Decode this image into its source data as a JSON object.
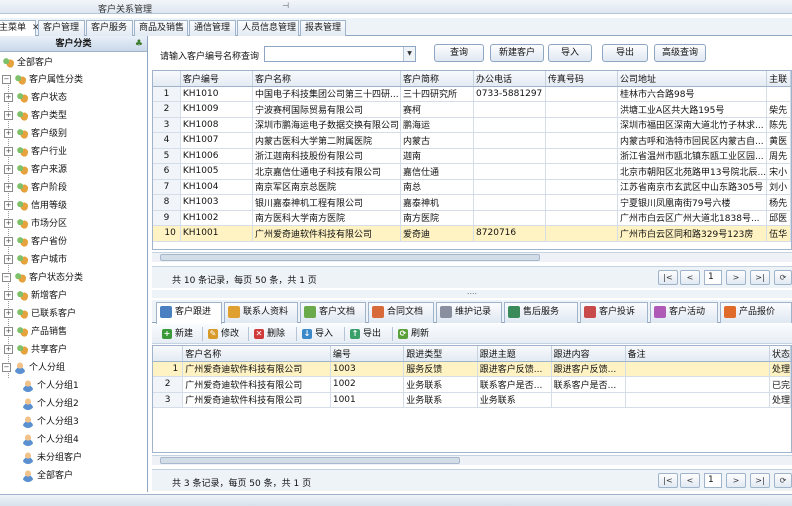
{
  "window": {
    "title": "客户关系管理"
  },
  "menu_tabs": [
    {
      "label": "主菜单"
    },
    {
      "label": "客户管理"
    },
    {
      "label": "客户服务"
    },
    {
      "label": "商品及销售"
    },
    {
      "label": "通信管理"
    },
    {
      "label": "人员信息管理"
    },
    {
      "label": "报表管理"
    }
  ],
  "sidebar": {
    "title": "客户分类",
    "items": [
      {
        "label": "全部客户"
      },
      {
        "label": "客户属性分类"
      },
      {
        "label": "客户状态"
      },
      {
        "label": "客户类型"
      },
      {
        "label": "客户级别"
      },
      {
        "label": "客户行业"
      },
      {
        "label": "客户来源"
      },
      {
        "label": "客户阶段"
      },
      {
        "label": "信用等级"
      },
      {
        "label": "市场分区"
      },
      {
        "label": "客户省份"
      },
      {
        "label": "客户城市"
      },
      {
        "label": "客户状态分类"
      },
      {
        "label": "新增客户"
      },
      {
        "label": "已联系客户"
      },
      {
        "label": "产品销售"
      },
      {
        "label": "共享客户"
      },
      {
        "label": "个人分组"
      },
      {
        "label": "个人分组1"
      },
      {
        "label": "个人分组2"
      },
      {
        "label": "个人分组3"
      },
      {
        "label": "个人分组4"
      },
      {
        "label": "未分组客户"
      },
      {
        "label": "全部客户"
      }
    ]
  },
  "search": {
    "label": "请输入客户编号名称查询",
    "value": "",
    "buttons": [
      "查询",
      "新建客户",
      "导入",
      "导出",
      "高级查询"
    ]
  },
  "customers": {
    "columns": [
      "",
      "客户编号",
      "客户名称",
      "客户简称",
      "办公电话",
      "传真号码",
      "公司地址",
      "主联"
    ],
    "rows": [
      [
        "1",
        "KH1010",
        "中国电子科技集团公司第三十四研...",
        "三十四研究所",
        "0733-5881297",
        "",
        "桂林市六合路98号",
        ""
      ],
      [
        "2",
        "KH1009",
        "宁波赛柯国际贸易有限公司",
        "赛柯",
        "",
        "",
        "洪塘工业A区共大路195号",
        "柴先"
      ],
      [
        "3",
        "KH1008",
        "深圳市鹏海运电子数据交换有限公司",
        "鹏海运",
        "",
        "",
        "深圳市福田区深南大道北竹子林求...",
        "陈先"
      ],
      [
        "4",
        "KH1007",
        "内蒙古医科大学第二附属医院",
        "内蒙古",
        "",
        "",
        "内蒙古呼和浩特市回民区内蒙古自...",
        "黄医"
      ],
      [
        "5",
        "KH1006",
        "浙江迦南科技股份有限公司",
        "迦南",
        "",
        "",
        "浙江省温州市瓯北镇东瓯工业区园...",
        "周先"
      ],
      [
        "6",
        "KH1005",
        "北京嘉信仕通电子科技有限公司",
        "嘉信仕通",
        "",
        "",
        "北京市朝阳区北苑路甲13号院北辰...",
        "宋小"
      ],
      [
        "7",
        "KH1004",
        "南京军区南京总医院",
        "南总",
        "",
        "",
        "江苏省南京市玄武区中山东路305号",
        "刘小"
      ],
      [
        "8",
        "KH1003",
        "银川嘉泰神机工程有限公司",
        "嘉泰神机",
        "",
        "",
        "宁夏银川凤凰南街79号六楼",
        "杨先"
      ],
      [
        "9",
        "KH1002",
        "南方医科大学南方医院",
        "南方医院",
        "",
        "",
        "广州市白云区广州大道北1838号...",
        "邱医"
      ],
      [
        "10",
        "KH1001",
        "广州爱奇迪软件科技有限公司",
        "爱奇迪",
        "8720716",
        "",
        "广州市白云区同和路329号123房",
        "伍华"
      ]
    ],
    "selected_row": 9,
    "pager_info": "共 10 条记录，每页 50 条，共 1 页",
    "page": "1"
  },
  "sub_tabs": [
    {
      "label": "客户跟进"
    },
    {
      "label": "联系人资料"
    },
    {
      "label": "客户文档"
    },
    {
      "label": "合同文档"
    },
    {
      "label": "维护记录"
    },
    {
      "label": "售后服务"
    },
    {
      "label": "客户投诉"
    },
    {
      "label": "客户活动"
    },
    {
      "label": "产品报价"
    }
  ],
  "toolbar": [
    "新建",
    "修改",
    "删除",
    "导入",
    "导出",
    "刷新"
  ],
  "followups": {
    "columns": [
      "",
      "客户名称",
      "编号",
      "跟进类型",
      "跟进主题",
      "跟进内容",
      "备注",
      "状态"
    ],
    "rows": [
      [
        "1",
        "广州爱奇迪软件科技有限公司",
        "1003",
        "服务反馈",
        "跟进客户反馈...",
        "跟进客户反馈...",
        "",
        "处理"
      ],
      [
        "2",
        "广州爱奇迪软件科技有限公司",
        "1002",
        "业务联系",
        "联系客户是否...",
        "联系客户是否...",
        "",
        "已完"
      ],
      [
        "3",
        "广州爱奇迪软件科技有限公司",
        "1001",
        "业务联系",
        "业务联系",
        "",
        "",
        "处理"
      ]
    ],
    "selected_row": 0,
    "pager_info": "共 3 条记录，每页 50 条，共 1 页",
    "page": "1"
  },
  "colors": {
    "accent": "#8fa6c2",
    "selected_row": "#fff3c4"
  }
}
